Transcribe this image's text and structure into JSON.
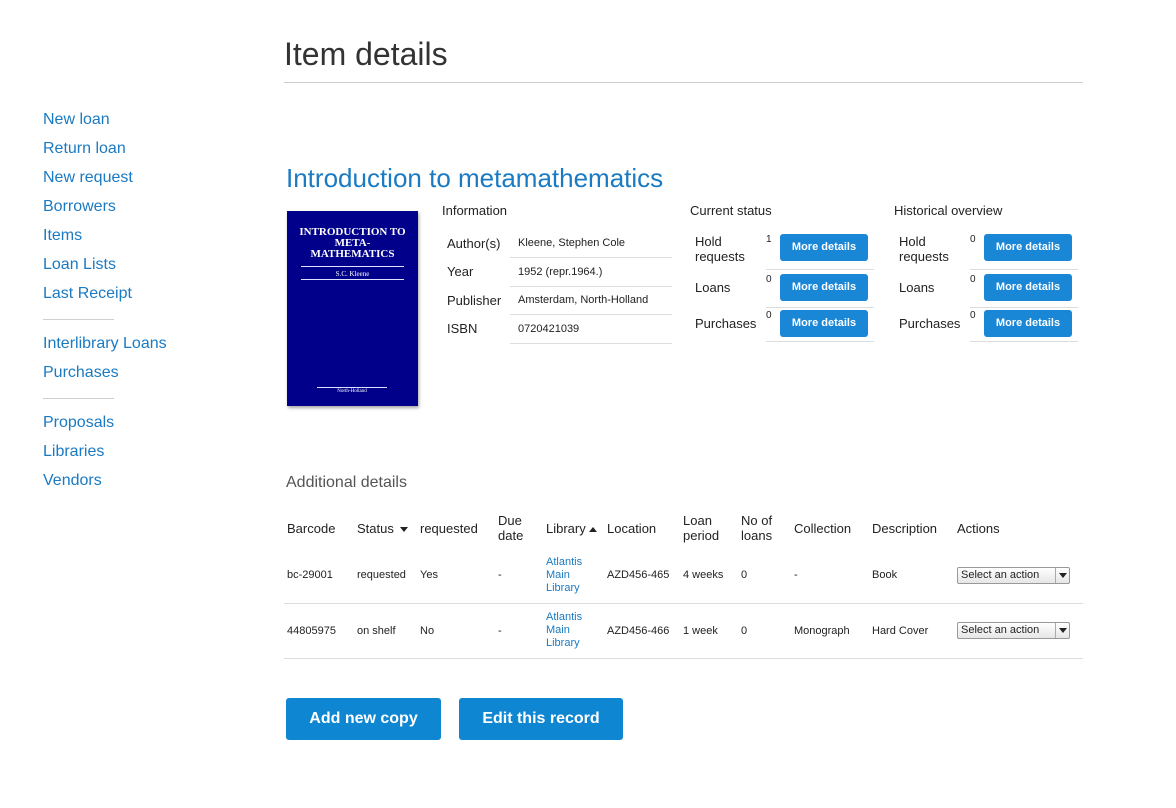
{
  "page": {
    "title": "Item details"
  },
  "sidebar": {
    "group1": [
      "New loan",
      "Return loan",
      "New request",
      "Borrowers",
      "Items",
      "Loan Lists",
      "Last Receipt"
    ],
    "group2": [
      "Interlibrary Loans",
      "Purchases"
    ],
    "group3": [
      "Proposals",
      "Libraries",
      "Vendors"
    ]
  },
  "book": {
    "title": "Introduction to metamathematics",
    "cover": {
      "title": "INTRODUCTION TO META-MATHEMATICS",
      "author": "S.C. Kleene",
      "publisher": "North-Holland",
      "color": "#00008b"
    }
  },
  "information": {
    "heading": "Information",
    "rows": [
      {
        "key": "Author(s)",
        "value": "Kleene, Stephen Cole"
      },
      {
        "key": "Year",
        "value": "1952 (repr.1964.)"
      },
      {
        "key": "Publisher",
        "value": "Amsterdam, North-Holland"
      },
      {
        "key": "ISBN",
        "value": "0720421039"
      }
    ]
  },
  "current_status": {
    "heading": "Current status",
    "rows": [
      {
        "label": "Hold requests",
        "count": "1",
        "button": "More details"
      },
      {
        "label": "Loans",
        "count": "0",
        "button": "More details"
      },
      {
        "label": "Purchases",
        "count": "0",
        "button": "More details"
      }
    ]
  },
  "historical_overview": {
    "heading": "Historical overview",
    "rows": [
      {
        "label": "Hold requests",
        "count": "0",
        "button": "More details"
      },
      {
        "label": "Loans",
        "count": "0",
        "button": "More details"
      },
      {
        "label": "Purchases",
        "count": "0",
        "button": "More details"
      }
    ]
  },
  "additional": {
    "heading": "Additional details",
    "columns": [
      "Barcode",
      "Status",
      "requested",
      "Due date",
      "Library",
      "Location",
      "Loan period",
      "No of loans",
      "Collection",
      "Description",
      "Actions"
    ],
    "rows": [
      {
        "barcode": "bc-29001",
        "status": "requested",
        "requested": "Yes",
        "due": "-",
        "library": "Atlantis Main Library",
        "location": "AZD456-465",
        "period": "4 weeks",
        "loans": "0",
        "collection": "-",
        "description": "Book",
        "action": "Select an action"
      },
      {
        "barcode": "44805975",
        "status": "on shelf",
        "requested": "No",
        "due": "-",
        "library": "Atlantis Main Library",
        "location": "AZD456-466",
        "period": "1 week",
        "loans": "0",
        "collection": "Monograph",
        "description": "Hard Cover",
        "action": "Select an action"
      }
    ]
  },
  "buttons": {
    "add_copy": "Add new copy",
    "edit_record": "Edit this record"
  },
  "colors": {
    "link": "#1a7ac2",
    "button": "#1a86d6"
  }
}
